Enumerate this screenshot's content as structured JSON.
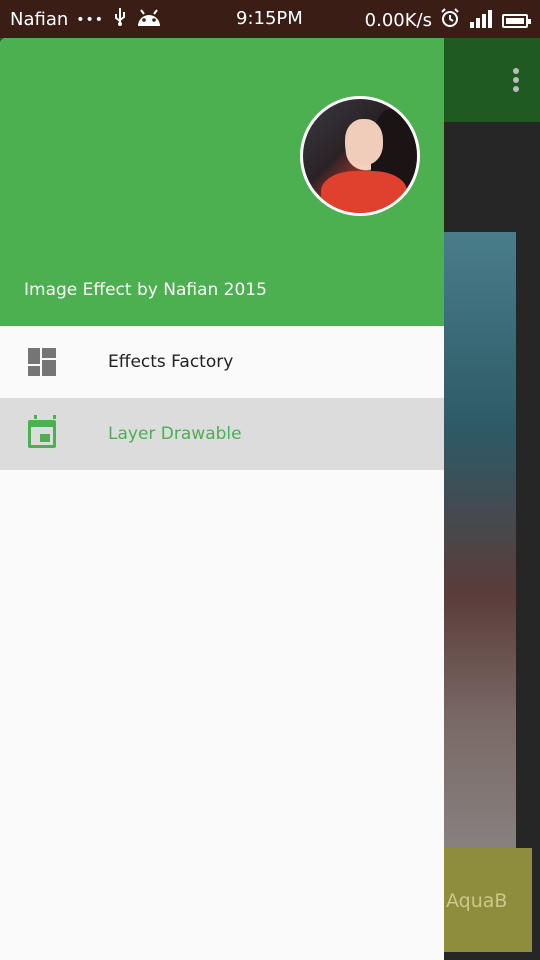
{
  "status_bar": {
    "carrier": "Nafian",
    "dots": "•••",
    "time": "9:15PM",
    "speed": "0.00K/s"
  },
  "app": {
    "button_label": "AquaB"
  },
  "drawer": {
    "header_title": "Image Effect by Nafian 2015",
    "items": [
      {
        "label": "Effects Factory",
        "icon": "dashboard-icon",
        "active": false
      },
      {
        "label": "Layer Drawable",
        "icon": "calendar-icon",
        "active": true
      }
    ]
  },
  "colors": {
    "accent": "#4caf50",
    "active_row": "#dcdcdc",
    "status_bar": "#3a1e16"
  }
}
